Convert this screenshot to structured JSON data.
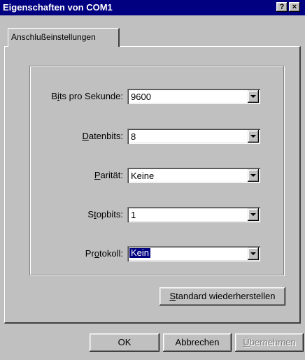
{
  "window": {
    "title": "Eigenschaften von COM1",
    "help_label": "?",
    "close_label": "×"
  },
  "tab": {
    "label": "Anschlußeinstellungen"
  },
  "fields": {
    "bits": {
      "label_pre": "B",
      "label_ul": "i",
      "label_post": "ts pro Sekunde:",
      "value": "9600"
    },
    "databits": {
      "label_pre": "",
      "label_ul": "D",
      "label_post": "atenbits:",
      "value": "8"
    },
    "parity": {
      "label_pre": "",
      "label_ul": "P",
      "label_post": "arität:",
      "value": "Keine"
    },
    "stopbits": {
      "label_pre": "S",
      "label_ul": "t",
      "label_post": "opbits:",
      "value": "1"
    },
    "protocol": {
      "label_pre": "Pr",
      "label_ul": "o",
      "label_post": "tokoll:",
      "value": "Kein"
    }
  },
  "buttons": {
    "restore_ul": "S",
    "restore_rest": "tandard wiederherstellen",
    "ok": "OK",
    "cancel": "Abbrechen",
    "apply_ul": "Ü",
    "apply_rest": "bernehmen"
  }
}
